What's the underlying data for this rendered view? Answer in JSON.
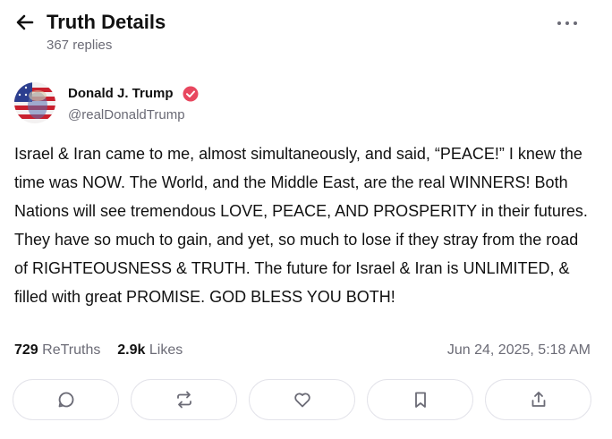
{
  "header": {
    "title": "Truth Details",
    "replies": "367 replies"
  },
  "author": {
    "name": "Donald J. Trump",
    "handle": "@realDonaldTrump",
    "verified_color": "#e8475f"
  },
  "post": {
    "text": "Israel & Iran came to me, almost simultaneously, and said, “PEACE!” I knew the time was NOW. The World, and the Middle East, are the real WINNERS! Both Nations will see tremendous LOVE, PEACE, AND PROSPERITY in their futures. They have so much to gain, and yet, so much to lose if they stray from the road of RIGHTEOUSNESS & TRUTH. The future for Israel & Iran is UNLIMITED, & filled with great PROMISE. GOD BLESS YOU BOTH!"
  },
  "stats": {
    "retruths_count": "729",
    "retruths_label": "ReTruths",
    "likes_count": "2.9k",
    "likes_label": "Likes",
    "timestamp": "Jun 24, 2025, 5:18 AM"
  },
  "actions": [
    {
      "icon": "reply-icon"
    },
    {
      "icon": "retruth-icon"
    },
    {
      "icon": "like-icon"
    },
    {
      "icon": "bookmark-icon"
    },
    {
      "icon": "share-icon"
    }
  ],
  "colors": {
    "text": "#111111",
    "muted": "#6b6b76",
    "border": "#e3e3ea",
    "accent": "#e8475f"
  }
}
